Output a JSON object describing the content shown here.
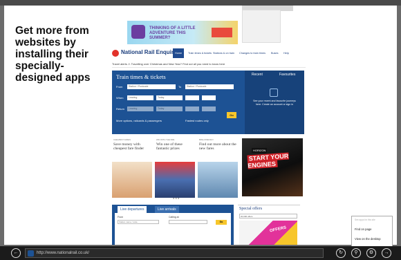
{
  "tip": {
    "text": "Get more from websites by installing their specially-designed apps"
  },
  "ad": {
    "text": "THINKING OF A LITTLE ADVENTURE THIS SUMMER?"
  },
  "site": {
    "logo": "National Rail Enquiries",
    "nav": [
      "Home",
      "Train times & tickets",
      "Stations & on train",
      "Changes to train times",
      "Buses",
      "Help"
    ],
    "notice": "Travel alerts  ⚠  Travelling over Christmas and New Year? Find out all you need to know here",
    "train_title": "Train times & tickets",
    "labels": {
      "from": "From",
      "to": "To",
      "when": "When",
      "return": "Return",
      "more": "More options, railcards & passengers",
      "cheap": "Fastest routes only"
    },
    "inputs": {
      "from": "Station / Postcode",
      "to": "Station / Postcode",
      "when_a": "Leaving",
      "when_b": "Today",
      "ret_a": "Leaving",
      "ret_b": "Today"
    },
    "go": "Go",
    "recent": {
      "tab1": "Recent",
      "tab2": "Favourites",
      "text": "See your recent and favourite journeys here. Create an account or sign in"
    },
    "promos": [
      {
        "head": "CHEAPEST FARES",
        "title": "Save money with cheapest fare finder"
      },
      {
        "head": "WIN WITH THE NRE",
        "title": "Win one of these fantastic prizes"
      },
      {
        "head": "BIKE-FRIENDLY",
        "title": "Find out more about the new fares"
      }
    ],
    "hero": {
      "tag": "HORIZON",
      "text": "START YOUR ENGINES"
    },
    "dots": "● ● ●",
    "live": {
      "tab1": "Live departures",
      "tab2": "Live arrivals",
      "from": "From",
      "for": "Calling at",
      "placeholder": "Station name / code",
      "go": "Go"
    },
    "offers": {
      "title": "Special offers",
      "select": "20,000 offers",
      "img_text": "OFFERS"
    }
  },
  "context_menu": {
    "header": "See apps for this site",
    "find": "Find on page",
    "desktop": "View on the desktop"
  },
  "app_bar": {
    "back": "←",
    "url": "http://www.nationalrail.co.uk/",
    "refresh": "↻",
    "pin": "⚲",
    "tools": "⚙",
    "forward": "→"
  }
}
